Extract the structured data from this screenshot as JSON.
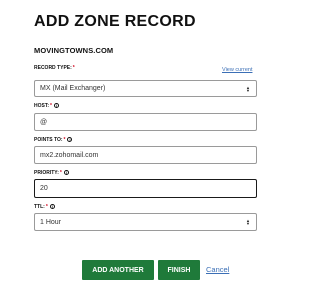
{
  "page": {
    "title": "ADD ZONE RECORD",
    "domain": "MOVINGTOWNS.COM",
    "view_current_link": "View current"
  },
  "form": {
    "record_type": {
      "label": "RECORD TYPE:",
      "required_mark": "*",
      "value": "MX (Mail Exchanger)"
    },
    "host": {
      "label": "HOST:",
      "required_mark": "*",
      "help_icon": "i",
      "value": "@"
    },
    "points_to": {
      "label": "POINTS TO:",
      "required_mark": "*",
      "help_icon": "i",
      "value": "mx2.zohomail.com"
    },
    "priority": {
      "label": "PRIORITY:",
      "required_mark": "*",
      "help_icon": "i",
      "value": "20"
    },
    "ttl": {
      "label": "TTL:",
      "required_mark": "*",
      "help_icon": "i",
      "value": "1 Hour"
    }
  },
  "actions": {
    "add_another": "ADD ANOTHER",
    "finish": "FINISH",
    "cancel": "Cancel"
  },
  "colors": {
    "primary_button": "#1f7a3a",
    "link": "#3b6fb6",
    "required": "#d0021b"
  }
}
